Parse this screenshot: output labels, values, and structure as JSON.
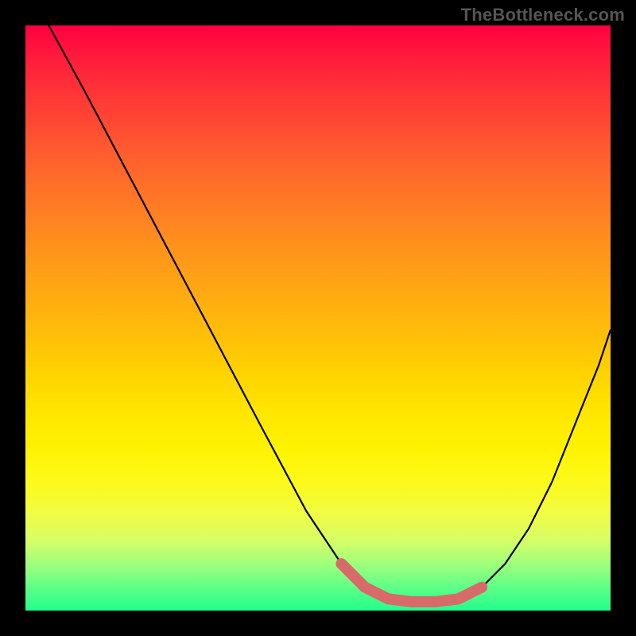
{
  "watermark": "TheBottleneck.com",
  "chart_data": {
    "type": "line",
    "title": "",
    "xlabel": "",
    "ylabel": "",
    "xlim": [
      0,
      100
    ],
    "ylim": [
      0,
      100
    ],
    "series": [
      {
        "name": "curve",
        "x": [
          4,
          10,
          20,
          30,
          40,
          48,
          54,
          58,
          62,
          66,
          70,
          74,
          78,
          82,
          86,
          90,
          94,
          98,
          100
        ],
        "y": [
          100,
          89,
          70,
          51,
          32,
          17,
          8,
          4,
          2,
          1.5,
          1.5,
          2,
          4,
          8,
          14,
          22,
          32,
          42,
          48
        ]
      }
    ],
    "highlight_segment": {
      "name": "trough-highlight",
      "x": [
        54,
        58,
        62,
        66,
        70,
        74,
        78
      ],
      "y": [
        8,
        4,
        2,
        1.5,
        1.5,
        2,
        4
      ]
    },
    "background_gradient": {
      "top": "#ff0040",
      "mid": "#ffd400",
      "bottom": "#22ff8c"
    }
  }
}
